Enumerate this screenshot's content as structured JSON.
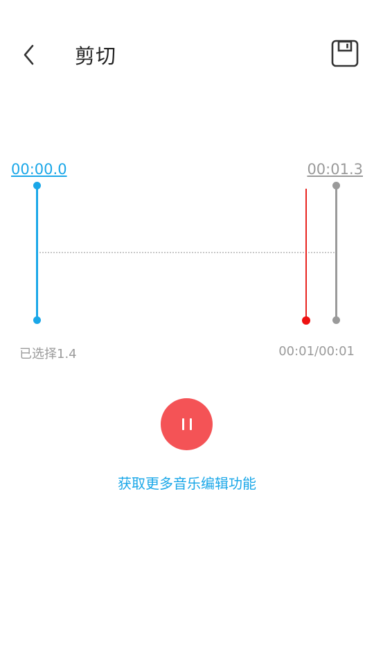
{
  "header": {
    "title": "剪切",
    "back_icon": "chevron-left-icon",
    "save_icon": "floppy-disk-icon"
  },
  "trim": {
    "start_time": "00:00.0",
    "end_time": "00:01.3",
    "selected_label": "已选择1.4",
    "progress_label": "00:01/00:01"
  },
  "player": {
    "state_icon": "pause-icon"
  },
  "more_link": "获取更多音乐编辑功能",
  "colors": {
    "accent": "#1aa7e8",
    "playhead": "#e8231e",
    "play_button": "#f45356",
    "muted": "#9a9a9a"
  }
}
